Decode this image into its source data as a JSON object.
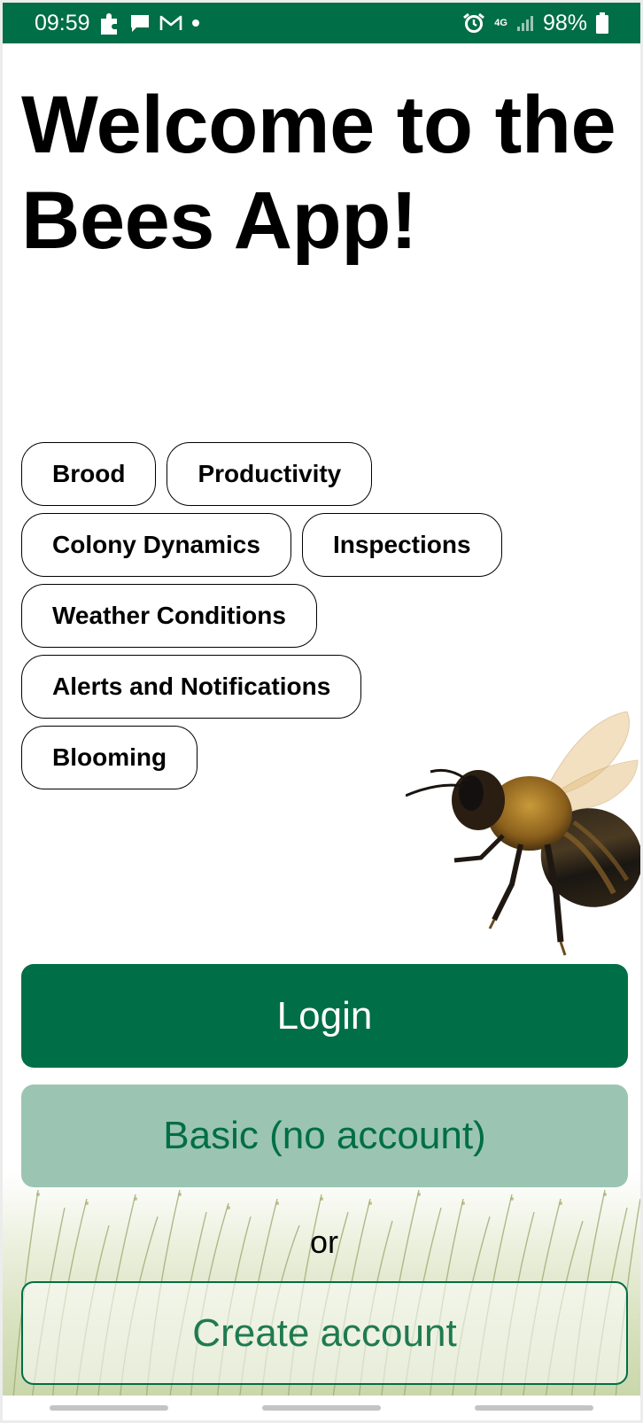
{
  "status_bar": {
    "time": "09:59",
    "notification_icons": [
      "puzzle-icon",
      "chat-icon",
      "gmail-icon",
      "dot-icon"
    ],
    "network_label": "4G",
    "battery_percent": "98%",
    "color": "#006e46"
  },
  "welcome": {
    "title": "Welcome to the Bees App!"
  },
  "topics": [
    [
      "Brood",
      "Productivity"
    ],
    [
      "Colony Dynamics",
      "Inspections"
    ],
    [
      "Weather Conditions"
    ],
    [
      "Alerts and Notifications"
    ],
    [
      "Blooming"
    ]
  ],
  "actions": {
    "login_label": "Login",
    "basic_label": "Basic (no account)",
    "or_label": "or",
    "create_label": "Create account"
  },
  "colors": {
    "brand_green": "#006e46",
    "basic_bg": "#9bc5b2"
  }
}
